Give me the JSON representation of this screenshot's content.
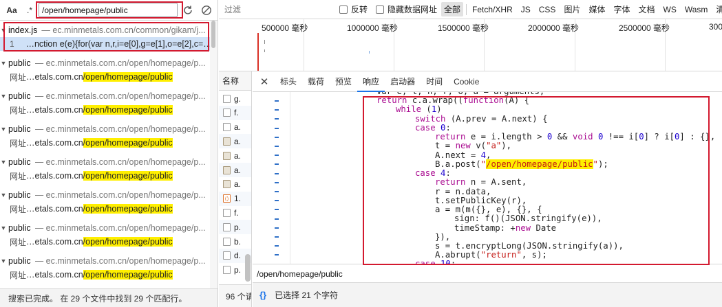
{
  "search_panel": {
    "case_toggle": "Aa",
    "regex_toggle": ".*",
    "query": "/open/homepage/public",
    "results": [
      {
        "file": "index.js",
        "url": "ec.minmetals.com.cn/common/gikam/j...",
        "match_label": "1",
        "match_text": "…nction e(e){for(var n,r,i=e[0],g=e[1],o=e[2],c=0,...",
        "match_hl": ""
      },
      {
        "file": "public",
        "url": "ec.minmetals.com.cn/open/homepage/p...",
        "match_label": "网址",
        "match_text": "…etals.com.cn",
        "match_hl": "/open/homepage/public"
      },
      {
        "file": "public",
        "url": "ec.minmetals.com.cn/open/homepage/p...",
        "match_label": "网址",
        "match_text": "…etals.com.cn",
        "match_hl": "/open/homepage/public"
      },
      {
        "file": "public",
        "url": "ec.minmetals.com.cn/open/homepage/p...",
        "match_label": "网址",
        "match_text": "…etals.com.cn",
        "match_hl": "/open/homepage/public"
      },
      {
        "file": "public",
        "url": "ec.minmetals.com.cn/open/homepage/p...",
        "match_label": "网址",
        "match_text": "…etals.com.cn",
        "match_hl": "/open/homepage/public"
      },
      {
        "file": "public",
        "url": "ec.minmetals.com.cn/open/homepage/p...",
        "match_label": "网址",
        "match_text": "…etals.com.cn",
        "match_hl": "/open/homepage/public"
      },
      {
        "file": "public",
        "url": "ec.minmetals.com.cn/open/homepage/p...",
        "match_label": "网址",
        "match_text": "…etals.com.cn",
        "match_hl": "/open/homepage/public"
      },
      {
        "file": "public",
        "url": "ec.minmetals.com.cn/open/homepage/p...",
        "match_label": "网址",
        "match_text": "…etals.com.cn",
        "match_hl": "/open/homepage/public"
      }
    ],
    "status": "搜索已完成。 在 29 个文件中找到 29 个匹配行。"
  },
  "filter_bar": {
    "placeholder": "过滤",
    "invert_label": "反转",
    "hide_data_urls_label": "隐藏数据网址",
    "types": [
      "全部",
      "Fetch/XHR",
      "JS",
      "CSS",
      "图片",
      "媒体",
      "字体",
      "文档",
      "WS",
      "Wasm",
      "清单"
    ]
  },
  "timeline": {
    "ticks": [
      "500000 毫秒",
      "1000000 毫秒",
      "1500000 毫秒",
      "2000000 毫秒",
      "2500000 毫秒",
      "300"
    ]
  },
  "requests": {
    "header": "名称",
    "rows": [
      {
        "name": "g.",
        "icon": "doc"
      },
      {
        "name": "f.",
        "icon": "doc"
      },
      {
        "name": "a.",
        "icon": "doc"
      },
      {
        "name": "a.",
        "icon": "img"
      },
      {
        "name": "a.",
        "icon": "img"
      },
      {
        "name": "a.",
        "icon": "img"
      },
      {
        "name": "a.",
        "icon": "img"
      },
      {
        "name": "1.",
        "icon": "orange"
      },
      {
        "name": "f.",
        "icon": "doc"
      },
      {
        "name": "p.",
        "icon": "doc"
      },
      {
        "name": "b.",
        "icon": "doc"
      },
      {
        "name": "d.",
        "icon": "doc"
      },
      {
        "name": "p.",
        "icon": "doc"
      }
    ],
    "footer": "96 个请"
  },
  "details": {
    "tabs": [
      "标头",
      "载荷",
      "预览",
      "响应",
      "启动器",
      "时间",
      "Cookie"
    ],
    "active_tab": "响应",
    "code_search_value": "/open/homepage/public",
    "selection_status": "已选择 21 个字符",
    "braces_label": "{}"
  },
  "colors": {
    "highlight": "#ffef00",
    "annotation_red": "#d3192f",
    "accent_blue": "#1a73e8"
  }
}
